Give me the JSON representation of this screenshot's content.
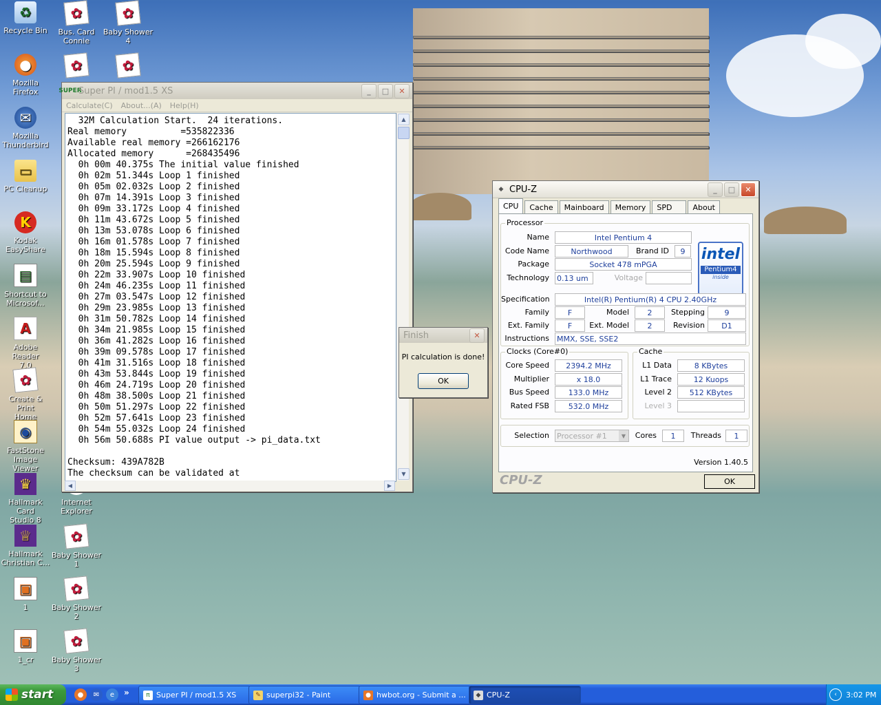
{
  "desktop": {
    "icons": [
      {
        "label": "Recycle Bin",
        "icon": "recycle-bin-icon"
      },
      {
        "label": "Bus. Card\nConnie",
        "icon": "rose-doc-icon"
      },
      {
        "label": "Baby Shower\n4",
        "icon": "rose-doc-icon"
      },
      {
        "label": "Mozilla Firefox",
        "icon": "firefox-icon"
      },
      {
        "label": "",
        "icon": "rose-doc-icon"
      },
      {
        "label": "",
        "icon": "rose-doc-icon"
      },
      {
        "label": "Mozilla\nThunderbird",
        "icon": "thunderbird-icon"
      },
      {
        "label": "PC Cleanup",
        "icon": "folder-icon"
      },
      {
        "label": "Kodak\nEasyShare",
        "icon": "kodak-icon"
      },
      {
        "label": "Shortcut to\nMicrosof...",
        "icon": "shortcut-doc-icon"
      },
      {
        "label": "Adobe Reader\n7.0",
        "icon": "adobe-reader-icon"
      },
      {
        "label": "Create & Print\nHome",
        "icon": "rose-doc-icon"
      },
      {
        "label": "FastStone\nImage Viewer",
        "icon": "faststone-icon"
      },
      {
        "label": "Hallmark Card\nStudio 8",
        "icon": "hallmark-icon"
      },
      {
        "label": "Internet\nExplorer",
        "icon": "internet-explorer-icon"
      },
      {
        "label": "Hallmark\nChristian C...",
        "icon": "hallmark-crown-icon"
      },
      {
        "label": "Baby Shower\n1",
        "icon": "rose-doc-icon"
      },
      {
        "label": "1",
        "icon": "image-file-icon"
      },
      {
        "label": "Baby Shower\n2",
        "icon": "rose-doc-icon"
      },
      {
        "label": "1_cr",
        "icon": "image-file-icon"
      },
      {
        "label": "Baby Shower\n3",
        "icon": "rose-doc-icon"
      }
    ]
  },
  "superpi": {
    "title": "Super PI / mod1.5 XS",
    "icon_text": "SUPER",
    "menu": [
      "Calculate(C)",
      "About...(A)",
      "Help(H)"
    ],
    "output_lines": [
      "  32M Calculation Start.  24 iterations.",
      "Real memory          =535822336",
      "Available real memory =266162176",
      "Allocated memory      =268435496",
      "  0h 00m 40.375s The initial value finished",
      "  0h 02m 51.344s Loop 1 finished",
      "  0h 05m 02.032s Loop 2 finished",
      "  0h 07m 14.391s Loop 3 finished",
      "  0h 09m 33.172s Loop 4 finished",
      "  0h 11m 43.672s Loop 5 finished",
      "  0h 13m 53.078s Loop 6 finished",
      "  0h 16m 01.578s Loop 7 finished",
      "  0h 18m 15.594s Loop 8 finished",
      "  0h 20m 25.594s Loop 9 finished",
      "  0h 22m 33.907s Loop 10 finished",
      "  0h 24m 46.235s Loop 11 finished",
      "  0h 27m 03.547s Loop 12 finished",
      "  0h 29m 23.985s Loop 13 finished",
      "  0h 31m 50.782s Loop 14 finished",
      "  0h 34m 21.985s Loop 15 finished",
      "  0h 36m 41.282s Loop 16 finished",
      "  0h 39m 09.578s Loop 17 finished",
      "  0h 41m 31.516s Loop 18 finished",
      "  0h 43m 53.844s Loop 19 finished",
      "  0h 46m 24.719s Loop 20 finished",
      "  0h 48m 38.500s Loop 21 finished",
      "  0h 50m 51.297s Loop 22 finished",
      "  0h 52m 57.641s Loop 23 finished",
      "  0h 54m 55.032s Loop 24 finished",
      "  0h 56m 50.688s PI value output -> pi_data.txt",
      "",
      "Checksum: 439A782B",
      "The checksum can be validated at"
    ]
  },
  "finish_dialog": {
    "title": "Finish",
    "message": "PI calculation is done!",
    "ok_label": "OK"
  },
  "cpuz": {
    "title": "CPU-Z",
    "tabs": [
      "CPU",
      "Cache",
      "Mainboard",
      "Memory",
      "SPD",
      "About"
    ],
    "active_tab": "CPU",
    "processor": {
      "group_label": "Processor",
      "name_label": "Name",
      "name": "Intel Pentium 4",
      "codename_label": "Code Name",
      "codename": "Northwood",
      "brandid_label": "Brand ID",
      "brandid": "9",
      "package_label": "Package",
      "package": "Socket 478 mPGA",
      "technology_label": "Technology",
      "technology": "0.13 um",
      "voltage_label": "Voltage",
      "voltage": "",
      "spec_label": "Specification",
      "spec": "Intel(R) Pentium(R) 4 CPU 2.40GHz",
      "family_label": "Family",
      "family": "F",
      "model_label": "Model",
      "model": "2",
      "stepping_label": "Stepping",
      "stepping": "9",
      "extfamily_label": "Ext. Family",
      "extfamily": "F",
      "extmodel_label": "Ext. Model",
      "extmodel": "2",
      "revision_label": "Revision",
      "revision": "D1",
      "instructions_label": "Instructions",
      "instructions": "MMX, SSE, SSE2",
      "logo_brand": "intel",
      "logo_product": "Pentium4",
      "logo_sub": "inside"
    },
    "clocks": {
      "group_label": "Clocks (Core#0)",
      "corespeed_label": "Core Speed",
      "corespeed": "2394.2 MHz",
      "multiplier_label": "Multiplier",
      "multiplier": "x 18.0",
      "busspeed_label": "Bus Speed",
      "busspeed": "133.0 MHz",
      "ratedfsb_label": "Rated FSB",
      "ratedfsb": "532.0 MHz"
    },
    "cache": {
      "group_label": "Cache",
      "l1data_label": "L1 Data",
      "l1data": "8 KBytes",
      "l1trace_label": "L1 Trace",
      "l1trace": "12 Kuops",
      "level2_label": "Level 2",
      "level2": "512 KBytes",
      "level3_label": "Level 3",
      "level3": ""
    },
    "selection_label": "Selection",
    "selection": "Processor #1",
    "cores_label": "Cores",
    "cores": "1",
    "threads_label": "Threads",
    "threads": "1",
    "version": "Version 1.40.5",
    "brand_watermark": "CPU-Z",
    "ok_label": "OK"
  },
  "taskbar": {
    "start_label": "start",
    "tasks": [
      {
        "label": "Super PI / mod1.5 XS",
        "icon": "superpi-icon",
        "active": false
      },
      {
        "label": "superpi32 - Paint",
        "icon": "paint-icon",
        "active": false
      },
      {
        "label": "hwbot.org - Submit a ...",
        "icon": "firefox-icon",
        "active": false
      },
      {
        "label": "CPU-Z",
        "icon": "cpuz-icon",
        "active": true
      }
    ],
    "clock": "3:02 PM"
  }
}
